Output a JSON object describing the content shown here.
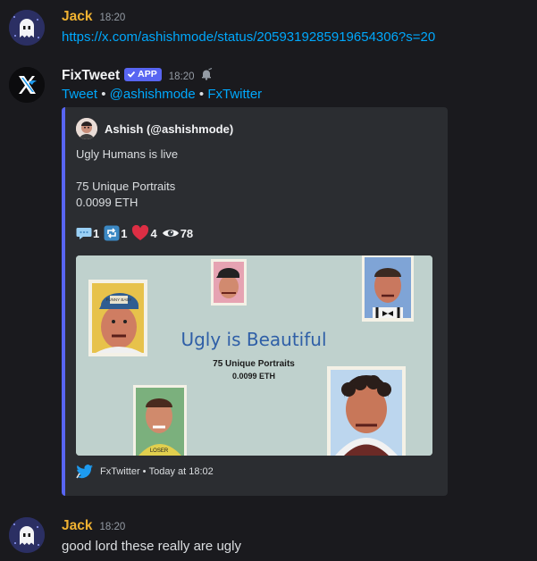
{
  "messages": [
    {
      "username": "Jack",
      "time": "18:20",
      "link": "https://x.com/ashishmode/status/2059319285919654306?s=20"
    },
    {
      "username": "FixTweet",
      "badge": "APP",
      "time": "18:20",
      "sub_links": {
        "tweet": "Tweet",
        "handle": "@ashishmode",
        "fx": "FxTwitter"
      },
      "embed": {
        "author": "Ashish (@ashishmode)",
        "desc": [
          "Ugly Humans is live",
          "",
          "75 Unique Portraits",
          "0.0099 ETH"
        ],
        "stats": {
          "replies": "1",
          "retweets": "1",
          "likes": "4",
          "views": "78"
        },
        "image": {
          "title": "Ugly is Beautiful",
          "line1": "75 Unique Portraits",
          "line2": "0.0099 ETH",
          "cap_text": "FUNNY BABY",
          "shirt_text": "LOSER"
        },
        "footer": {
          "name": "FxTwitter",
          "sep": " • ",
          "time": "Today at 18:02"
        },
        "accent": "#5865f2"
      }
    },
    {
      "username": "Jack",
      "time": "18:20",
      "text": "good lord these really are ugly"
    }
  ],
  "colors": {
    "background": "#1a1a1e",
    "username_jack": "#f0b232",
    "username_fixtweet": "#f2f3f5",
    "link": "#00a8fc",
    "embed_bg": "#2b2d31",
    "badge": "#5865f2"
  },
  "icons": [
    "ghost-avatar",
    "x-logo-avatar",
    "check-icon",
    "bell-icon",
    "speech-bubble-icon",
    "retweet-icon",
    "heart-icon",
    "eye-icon",
    "bird-icon"
  ]
}
